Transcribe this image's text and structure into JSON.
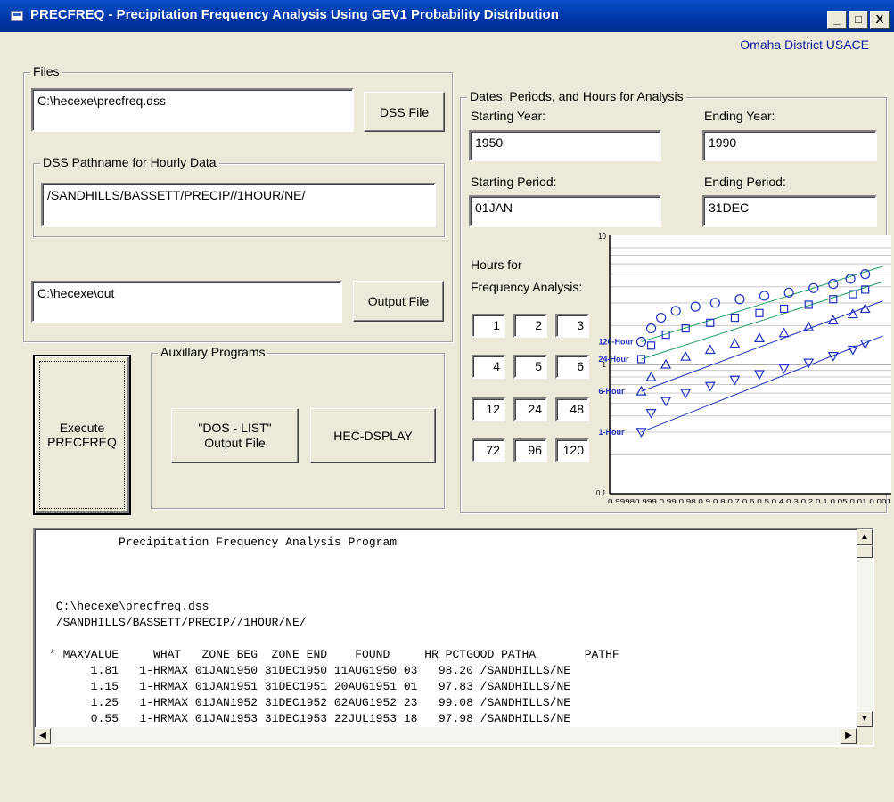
{
  "window": {
    "title": "PRECFREQ - Precipitation Frequency Analysis Using GEV1 Probability Distribution",
    "credit": "Omaha District USACE",
    "minimize": "_",
    "maximize": "□",
    "close": "X"
  },
  "files": {
    "group_label": "Files",
    "dss_file_value": "C:\\hecexe\\precfreq.dss",
    "dss_file_button": "DSS File",
    "pathname_group_label": "DSS Pathname for Hourly Data",
    "pathname_value": "/SANDHILLS/BASSETT/PRECIP//1HOUR/NE/",
    "output_file_value": "C:\\hecexe\\out",
    "output_file_button": "Output File"
  },
  "execute_button": "Execute\nPRECFREQ",
  "aux": {
    "group_label": "Auxillary Programs",
    "dos_list_button": "\"DOS - LIST\"\nOutput File",
    "hec_dsplay_button": "HEC-DSPLAY"
  },
  "dates": {
    "group_label": "Dates, Periods, and Hours for Analysis",
    "starting_year_label": "Starting Year:",
    "starting_year_value": "1950",
    "ending_year_label": "Ending Year:",
    "ending_year_value": "1990",
    "starting_period_label": "Starting Period:",
    "starting_period_value": "01JAN",
    "ending_period_label": "Ending Period:",
    "ending_period_value": "31DEC",
    "hours_label_1": "Hours for",
    "hours_label_2": "Frequency Analysis:",
    "hours": [
      "1",
      "2",
      "3",
      "4",
      "5",
      "6",
      "12",
      "24",
      "48",
      "72",
      "96",
      "120"
    ]
  },
  "chart_data": {
    "type": "scatter",
    "yscale": "log",
    "ylim": [
      0.1,
      10
    ],
    "ytick_labels": [
      "10",
      "1",
      "0.1"
    ],
    "xtick_labels": "0.9998 0.999 0.99 0.98 0.9 0.8 0.7 0.6 0.5 0.4 0.3 0.2 0.1 0.05 0.01 0.001",
    "xtick_labels_rendered": "0.99980.999  0.99   0.98 0.9 0.8 0.7 0.6 0.5 0.4 0.3 0.2 0.1 0.05  0.01  0.001",
    "grid": true,
    "series": [
      {
        "name": "120-Hour",
        "color": "#2030c0",
        "line_color": "#20a060",
        "marker": "circle",
        "points": [
          [
            0.02,
            1.5
          ],
          [
            0.06,
            1.9
          ],
          [
            0.1,
            2.3
          ],
          [
            0.16,
            2.6
          ],
          [
            0.24,
            2.8
          ],
          [
            0.32,
            3.0
          ],
          [
            0.42,
            3.2
          ],
          [
            0.52,
            3.4
          ],
          [
            0.62,
            3.6
          ],
          [
            0.72,
            3.9
          ],
          [
            0.8,
            4.2
          ],
          [
            0.87,
            4.6
          ],
          [
            0.93,
            5.0
          ]
        ]
      },
      {
        "name": "24-Hour",
        "color": "#2030c0",
        "line_color": "#20a060",
        "marker": "square",
        "points": [
          [
            0.02,
            1.1
          ],
          [
            0.06,
            1.4
          ],
          [
            0.12,
            1.7
          ],
          [
            0.2,
            1.9
          ],
          [
            0.3,
            2.1
          ],
          [
            0.4,
            2.3
          ],
          [
            0.5,
            2.5
          ],
          [
            0.6,
            2.7
          ],
          [
            0.7,
            2.9
          ],
          [
            0.8,
            3.2
          ],
          [
            0.88,
            3.5
          ],
          [
            0.93,
            3.8
          ]
        ]
      },
      {
        "name": "6-Hour",
        "color": "#2030c0",
        "line_color": "#2030c0",
        "marker": "triangle-up",
        "points": [
          [
            0.02,
            0.62
          ],
          [
            0.06,
            0.8
          ],
          [
            0.12,
            1.0
          ],
          [
            0.2,
            1.15
          ],
          [
            0.3,
            1.3
          ],
          [
            0.4,
            1.45
          ],
          [
            0.5,
            1.6
          ],
          [
            0.6,
            1.75
          ],
          [
            0.7,
            1.95
          ],
          [
            0.8,
            2.2
          ],
          [
            0.88,
            2.45
          ],
          [
            0.93,
            2.7
          ]
        ]
      },
      {
        "name": "1-Hour",
        "color": "#2030c0",
        "line_color": "#2030c0",
        "marker": "triangle-down",
        "points": [
          [
            0.02,
            0.3
          ],
          [
            0.06,
            0.42
          ],
          [
            0.12,
            0.52
          ],
          [
            0.2,
            0.6
          ],
          [
            0.3,
            0.68
          ],
          [
            0.4,
            0.76
          ],
          [
            0.5,
            0.84
          ],
          [
            0.6,
            0.93
          ],
          [
            0.7,
            1.03
          ],
          [
            0.8,
            1.16
          ],
          [
            0.88,
            1.3
          ],
          [
            0.93,
            1.45
          ]
        ]
      }
    ]
  },
  "console": {
    "lines": [
      "          Precipitation Frequency Analysis Program",
      "",
      "",
      "",
      " C:\\hecexe\\precfreq.dss",
      " /SANDHILLS/BASSETT/PRECIP//1HOUR/NE/",
      "",
      "* MAXVALUE     WHAT   ZONE BEG  ZONE END    FOUND     HR PCTGOOD PATHA       PATHF",
      "      1.81   1-HRMAX 01JAN1950 31DEC1950 11AUG1950 03   98.20 /SANDHILLS/NE",
      "      1.15   1-HRMAX 01JAN1951 31DEC1951 20AUG1951 01   97.83 /SANDHILLS/NE",
      "      1.25   1-HRMAX 01JAN1952 31DEC1952 02AUG1952 23   99.08 /SANDHILLS/NE",
      "      0.55   1-HRMAX 01JAN1953 31DEC1953 22JUL1953 18   97.98 /SANDHILLS/NE"
    ]
  }
}
